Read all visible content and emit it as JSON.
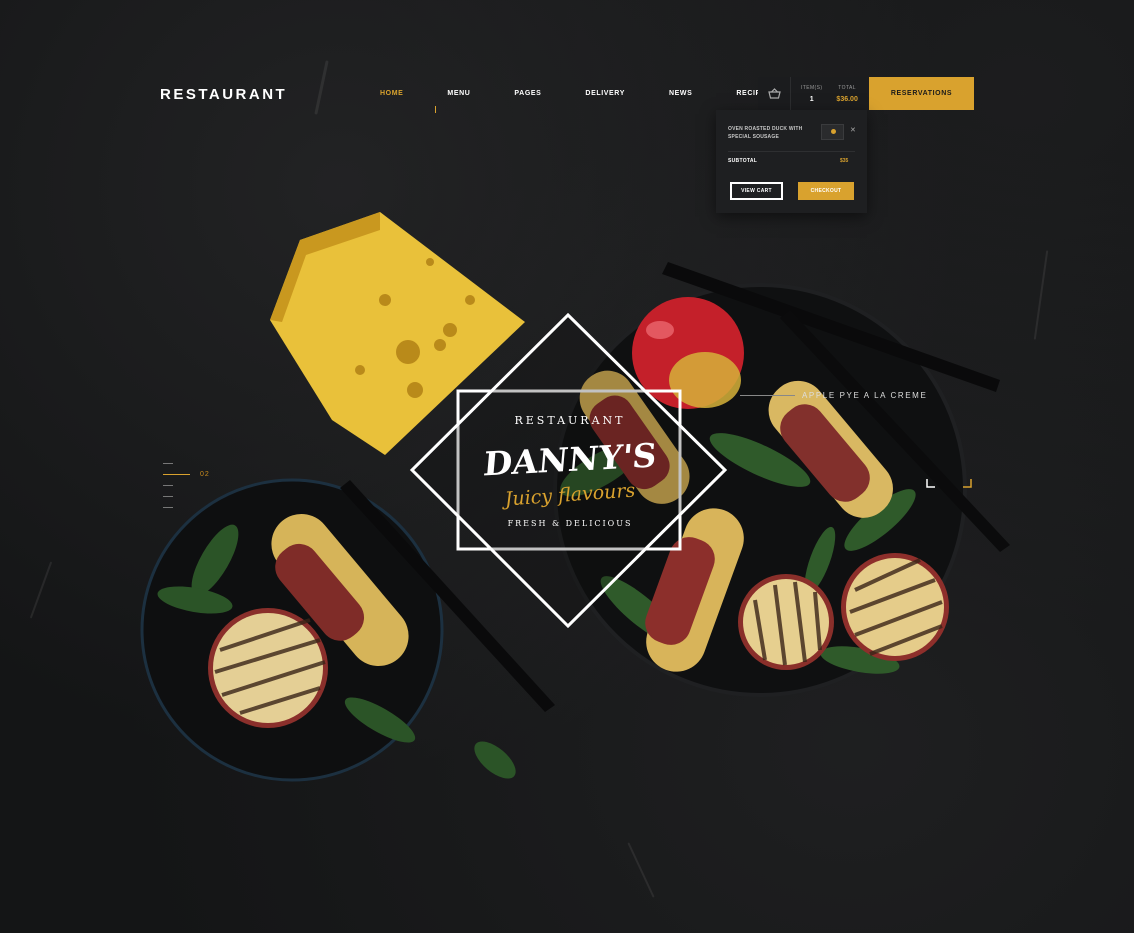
{
  "header": {
    "logo": "RESTAURANT",
    "nav": [
      {
        "label": "HOME",
        "active": true
      },
      {
        "label": "MENU",
        "active": false
      },
      {
        "label": "PAGES",
        "active": false
      },
      {
        "label": "DELIVERY",
        "active": false
      },
      {
        "label": "NEWS",
        "active": false
      },
      {
        "label": "RECIPES",
        "active": false
      }
    ],
    "cart": {
      "icon": "basket-icon",
      "items_label": "ITEM(S)",
      "items_value": "1",
      "total_label": "TOTAL",
      "total_value": "$36.00"
    },
    "reservations_label": "RESERVATIONS"
  },
  "cart_dropdown": {
    "item_name": "OVEN ROASTED DUCK WITH SPECIAL SOUSAGE",
    "close_icon": "close-icon",
    "subtotal_label": "SUBTOTAL",
    "subtotal_value": "$35",
    "view_cart_label": "VIEW CART",
    "checkout_label": "CHECKOUT"
  },
  "hero": {
    "emblem_top": "RESTAURANT",
    "emblem_brand": "DANNY'S",
    "emblem_tagline": "Juicy flavours",
    "emblem_sub": "FRESH & DELICIOUS",
    "caption": "APPLE PYE A LA CREME",
    "slide_number": "02"
  },
  "colors": {
    "accent": "#d9a22e",
    "background": "#141516"
  }
}
